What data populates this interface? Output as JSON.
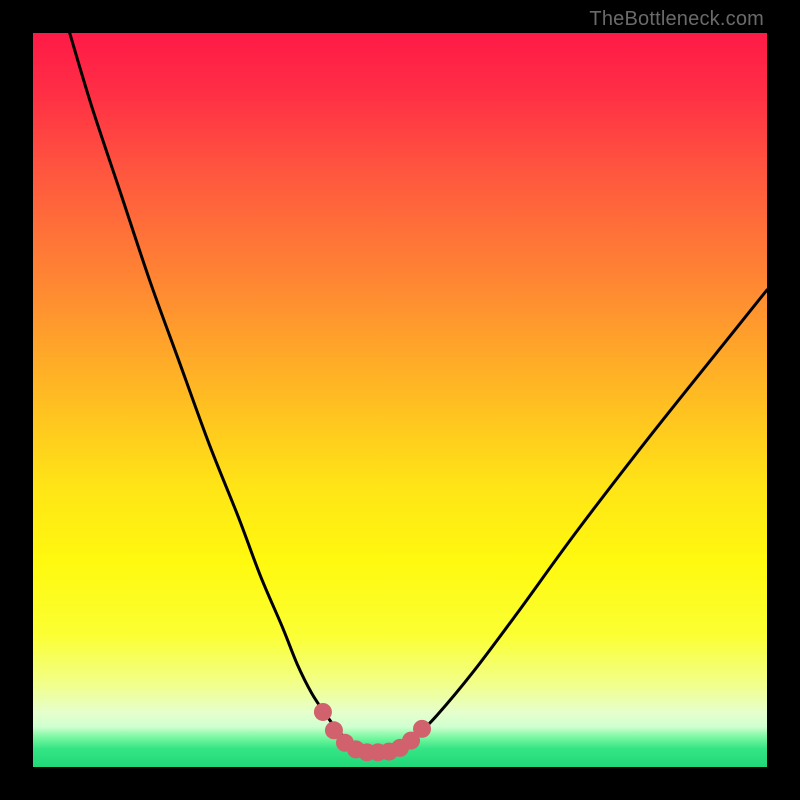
{
  "watermark": "TheBottleneck.com",
  "colors": {
    "frame": "#000000",
    "curve": "#000000",
    "marker": "#d1616c",
    "gradient_stops": [
      {
        "offset": 0.0,
        "color": "#ff1a47"
      },
      {
        "offset": 0.08,
        "color": "#ff2e45"
      },
      {
        "offset": 0.2,
        "color": "#ff5a3e"
      },
      {
        "offset": 0.35,
        "color": "#ff8a32"
      },
      {
        "offset": 0.5,
        "color": "#ffbd22"
      },
      {
        "offset": 0.62,
        "color": "#ffe516"
      },
      {
        "offset": 0.72,
        "color": "#fff90f"
      },
      {
        "offset": 0.82,
        "color": "#fbff33"
      },
      {
        "offset": 0.885,
        "color": "#f2ff88"
      },
      {
        "offset": 0.905,
        "color": "#ecffa8"
      },
      {
        "offset": 0.925,
        "color": "#e6ffcc"
      },
      {
        "offset": 0.945,
        "color": "#d0ffd0"
      },
      {
        "offset": 0.96,
        "color": "#77f7a0"
      },
      {
        "offset": 0.975,
        "color": "#35e585"
      },
      {
        "offset": 1.0,
        "color": "#20d878"
      }
    ]
  },
  "chart_data": {
    "type": "line",
    "title": "",
    "xlabel": "",
    "ylabel": "",
    "xlim": [
      0,
      100
    ],
    "ylim": [
      0,
      100
    ],
    "grid": false,
    "series": [
      {
        "name": "bottleneck-curve",
        "x": [
          5,
          8,
          12,
          16,
          20,
          24,
          28,
          31,
          34,
          36,
          38,
          40,
          41.5,
          43,
          44.5,
          46,
          48,
          50,
          52,
          55,
          60,
          66,
          74,
          84,
          96,
          100
        ],
        "y": [
          100,
          90,
          78,
          66,
          55,
          44,
          34,
          26,
          19,
          14,
          10,
          7,
          5,
          3.5,
          2.5,
          2,
          2,
          2.5,
          4,
          7,
          13,
          21,
          32,
          45,
          60,
          65
        ]
      }
    ],
    "markers": {
      "name": "curve-bottom-markers",
      "x": [
        39.5,
        41,
        42.5,
        44,
        45.5,
        47,
        48.5,
        50,
        51.5,
        53
      ],
      "y": [
        7.5,
        5,
        3.3,
        2.4,
        2,
        2,
        2.1,
        2.6,
        3.6,
        5.2
      ]
    }
  }
}
